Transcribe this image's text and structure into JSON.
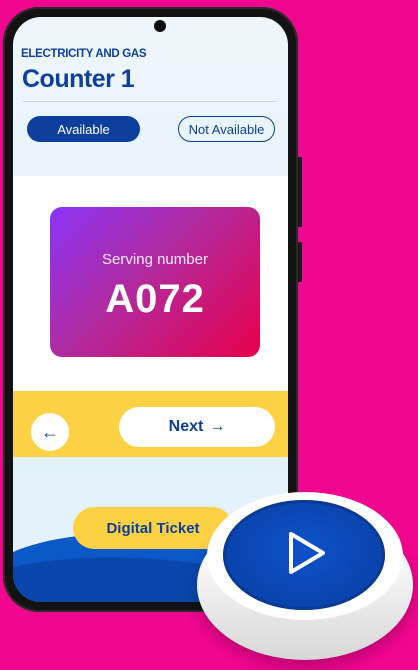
{
  "app": {
    "category": "ELECTRICITY AND GAS",
    "counter_title": "Counter 1"
  },
  "status": {
    "available_label": "Available",
    "not_available_label": "Not Available"
  },
  "serving": {
    "label": "Serving number",
    "number": "A072"
  },
  "controls": {
    "back_glyph": "←",
    "next_label": "Next",
    "next_glyph": "→",
    "digital_ticket_label": "Digital Ticket"
  },
  "icons": {
    "back": "arrow-left-icon",
    "next": "arrow-right-icon",
    "play": "play-icon"
  },
  "colors": {
    "background": "#f0068f",
    "brand_blue": "#0c3f9e",
    "accent_yellow": "#fdd144",
    "card_gradient_start": "#8a34f6",
    "card_gradient_end": "#e8004a"
  }
}
